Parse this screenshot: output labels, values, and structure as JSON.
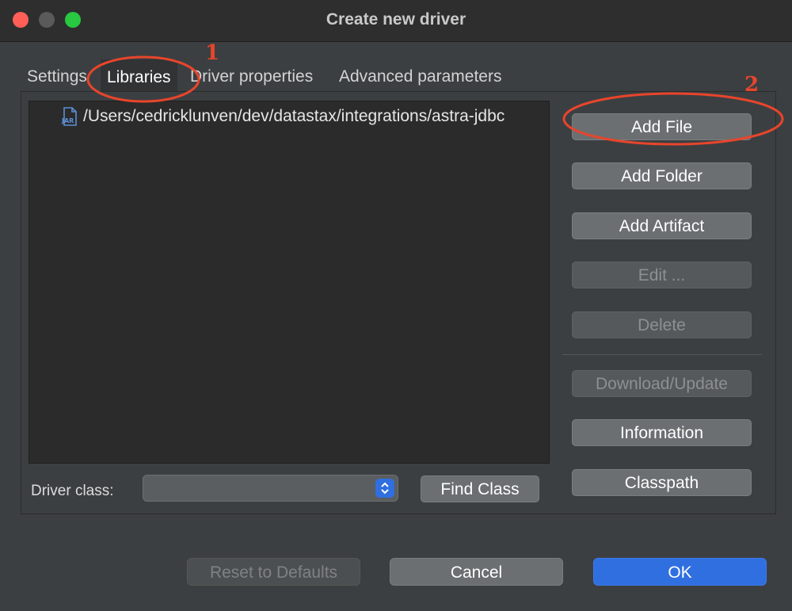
{
  "window": {
    "title": "Create new driver"
  },
  "tabs": [
    {
      "label": "Settings",
      "active": false
    },
    {
      "label": "Libraries",
      "active": true
    },
    {
      "label": "Driver properties",
      "active": false
    },
    {
      "label": "Advanced parameters",
      "active": false
    }
  ],
  "libraries": {
    "files": [
      {
        "icon": "jar-file-icon",
        "icon_text": "JAR",
        "path": "/Users/cedricklunven/dev/datastax/integrations/astra-jdbc"
      }
    ]
  },
  "side_buttons": {
    "add_file": "Add File",
    "add_folder": "Add Folder",
    "add_artifact": "Add Artifact",
    "edit": "Edit ...",
    "delete": "Delete",
    "download_update": "Download/Update",
    "information": "Information",
    "classpath": "Classpath"
  },
  "driver_class": {
    "label": "Driver class:",
    "value": ""
  },
  "find_class_label": "Find Class",
  "footer": {
    "reset_label": "Reset to Defaults",
    "cancel_label": "Cancel",
    "ok_label": "OK"
  },
  "annotations": [
    {
      "number": "1"
    },
    {
      "number": "2"
    }
  ],
  "colors": {
    "accent": "#2f6fe0",
    "annotation": "#e8452c",
    "close": "#ff5f57",
    "zoom": "#28c840"
  }
}
